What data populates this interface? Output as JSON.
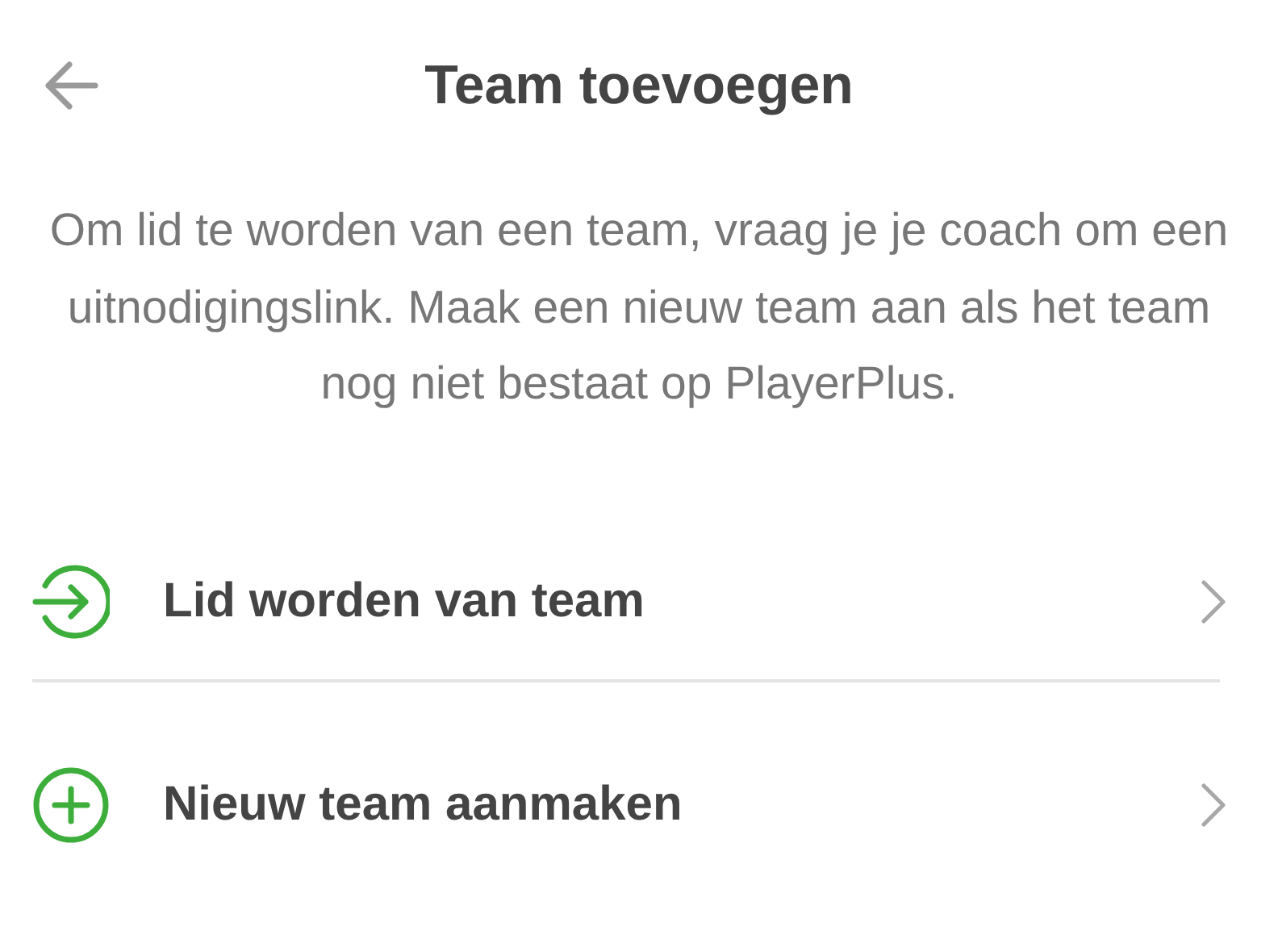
{
  "header": {
    "title": "Team toevoegen"
  },
  "intro": "Om lid te worden van een team, vraag je je coach om een uitnodigingslink. Maak een nieuw team aan als het team nog niet bestaat op PlayerPlus.",
  "actions": [
    {
      "kind": "join",
      "label": "Lid worden van team"
    },
    {
      "kind": "create",
      "label": "Nieuw team aanmaken"
    }
  ]
}
